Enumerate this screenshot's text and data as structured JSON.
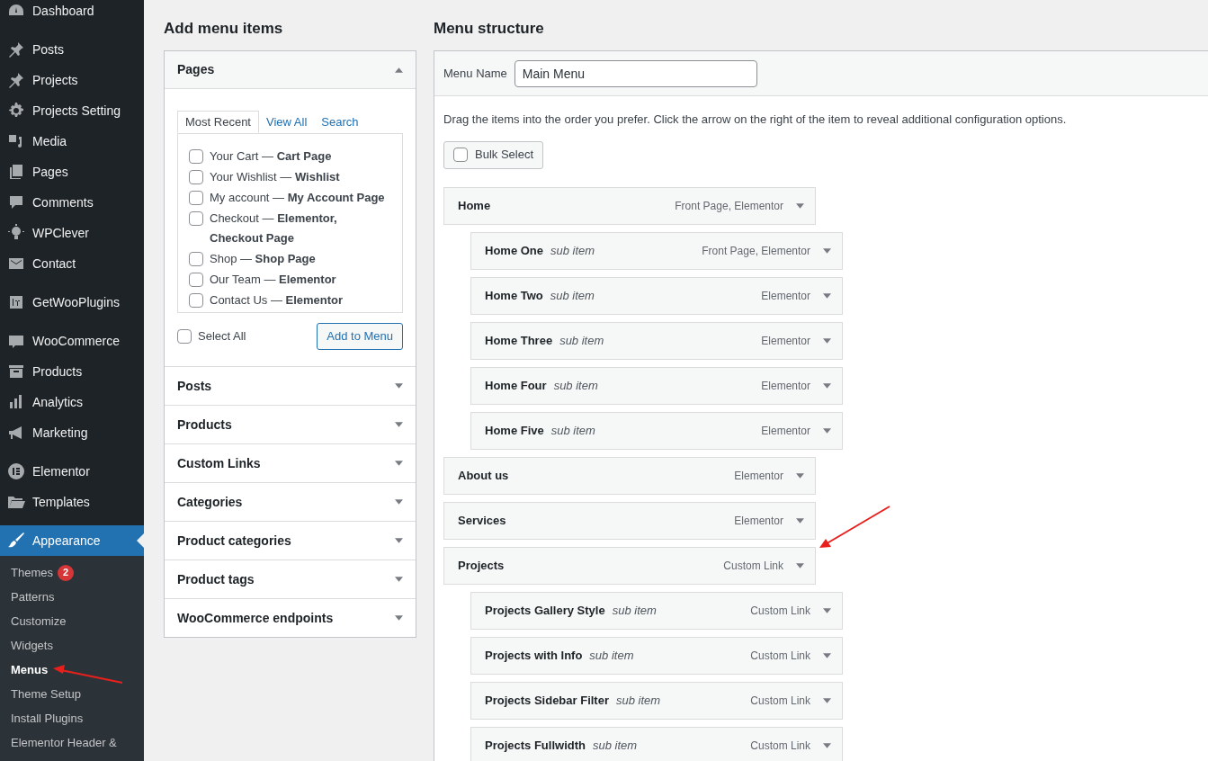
{
  "sidebar": {
    "groups": [
      {
        "items": [
          {
            "label": "Dashboard",
            "selected": false
          }
        ]
      },
      {
        "items": [
          {
            "label": "Posts",
            "selected": false
          },
          {
            "label": "Projects",
            "selected": false
          },
          {
            "label": "Projects Setting",
            "selected": false
          },
          {
            "label": "Media",
            "selected": false
          },
          {
            "label": "Pages",
            "selected": false
          },
          {
            "label": "Comments",
            "selected": false
          },
          {
            "label": "WPClever",
            "selected": false
          },
          {
            "label": "Contact",
            "selected": false
          }
        ]
      },
      {
        "items": [
          {
            "label": "GetWooPlugins",
            "selected": false
          }
        ]
      },
      {
        "items": [
          {
            "label": "WooCommerce",
            "selected": false
          },
          {
            "label": "Products",
            "selected": false
          },
          {
            "label": "Analytics",
            "selected": false
          },
          {
            "label": "Marketing",
            "selected": false
          }
        ]
      },
      {
        "items": [
          {
            "label": "Elementor",
            "selected": false
          },
          {
            "label": "Templates",
            "selected": false
          }
        ]
      },
      {
        "items": [
          {
            "label": "Appearance",
            "selected": true,
            "submenu": [
              {
                "label": "Themes",
                "badge": "2",
                "selected": false
              },
              {
                "label": "Patterns",
                "selected": false
              },
              {
                "label": "Customize",
                "selected": false
              },
              {
                "label": "Widgets",
                "selected": false
              },
              {
                "label": "Menus",
                "selected": true
              },
              {
                "label": "Theme Setup",
                "selected": false
              },
              {
                "label": "Install Plugins",
                "selected": false
              },
              {
                "label": "Elementor Header &",
                "selected": false
              }
            ]
          }
        ]
      }
    ]
  },
  "add_menu_items": {
    "title": "Add menu items",
    "sections": [
      {
        "title": "Pages",
        "expanded": true,
        "tabs": [
          {
            "label": "Most Recent",
            "selected": true
          },
          {
            "label": "View All",
            "selected": false
          },
          {
            "label": "Search",
            "selected": false
          }
        ],
        "items": [
          {
            "label": "Your Cart — **Cart Page**",
            "checked": false
          },
          {
            "label": "Your Wishlist — **Wishlist**",
            "checked": false
          },
          {
            "label": "My account — **My Account Page**",
            "checked": false
          },
          {
            "label": "Checkout — **Elementor, Checkout Page**",
            "checked": false
          },
          {
            "label": "Shop — **Shop Page**",
            "checked": false
          },
          {
            "label": "Our Team — **Elementor**",
            "checked": false
          },
          {
            "label": "Contact Us — **Elementor**",
            "checked": false
          }
        ],
        "select_all": {
          "label": "Select All",
          "checked": false
        },
        "button": "Add to Menu"
      },
      {
        "title": "Posts",
        "expanded": false
      },
      {
        "title": "Products",
        "expanded": false
      },
      {
        "title": "Custom Links",
        "expanded": false
      },
      {
        "title": "Categories",
        "expanded": false
      },
      {
        "title": "Product categories",
        "expanded": false
      },
      {
        "title": "Product tags",
        "expanded": false
      },
      {
        "title": "WooCommerce endpoints",
        "expanded": false
      }
    ]
  },
  "menu_structure": {
    "title": "Menu structure",
    "menu_name_label": "Menu Name",
    "menu_name": "Main Menu",
    "instructions": "Drag the items into the order you prefer. Click the arrow on the right of the item to reveal additional configuration options.",
    "bulk_select": {
      "label": "Bulk Select",
      "checked": false
    },
    "items": [
      {
        "title": "Home",
        "type": "Front Page, Elementor",
        "children": [
          {
            "title": "Home One",
            "sub_label": "sub item",
            "type": "Front Page, Elementor"
          },
          {
            "title": "Home Two",
            "sub_label": "sub item",
            "type": "Elementor"
          },
          {
            "title": "Home Three",
            "sub_label": "sub item",
            "type": "Elementor"
          },
          {
            "title": "Home Four",
            "sub_label": "sub item",
            "type": "Elementor"
          },
          {
            "title": "Home Five",
            "sub_label": "sub item",
            "type": "Elementor"
          }
        ]
      },
      {
        "title": "About us",
        "type": "Elementor"
      },
      {
        "title": "Services",
        "type": "Elementor"
      },
      {
        "title": "Projects",
        "type": "Custom Link",
        "children": [
          {
            "title": "Projects Gallery Style",
            "sub_label": "sub item",
            "type": "Custom Link"
          },
          {
            "title": "Projects with Info",
            "sub_label": "sub item",
            "type": "Custom Link"
          },
          {
            "title": "Projects Sidebar Filter",
            "sub_label": "sub item",
            "type": "Custom Link"
          },
          {
            "title": "Projects Fullwidth",
            "sub_label": "sub item",
            "type": "Custom Link"
          }
        ]
      }
    ]
  }
}
